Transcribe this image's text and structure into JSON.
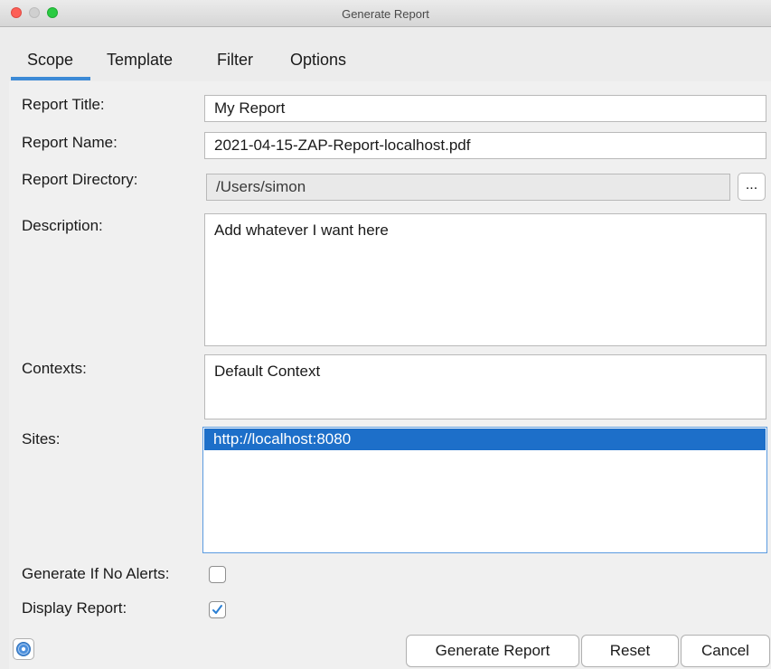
{
  "window": {
    "title": "Generate Report"
  },
  "tabs": [
    {
      "label": "Scope"
    },
    {
      "label": "Template"
    },
    {
      "label": "Filter"
    },
    {
      "label": "Options"
    }
  ],
  "form": {
    "report_title": {
      "label": "Report Title:",
      "value": "My Report"
    },
    "report_name": {
      "label": "Report Name:",
      "value": "2021-04-15-ZAP-Report-localhost.pdf"
    },
    "report_directory": {
      "label": "Report Directory:",
      "value": "/Users/simon",
      "browse_label": "..."
    },
    "description": {
      "label": "Description:",
      "value": "Add whatever I want here"
    },
    "contexts": {
      "label": "Contexts:",
      "items": [
        "Default Context"
      ]
    },
    "sites": {
      "label": "Sites:",
      "items": [
        "http://localhost:8080"
      ],
      "selected": "http://localhost:8080"
    },
    "generate_if_no_alerts": {
      "label": "Generate If No Alerts:",
      "checked": false
    },
    "display_report": {
      "label": "Display Report:",
      "checked": true
    }
  },
  "buttons": {
    "generate": "Generate Report",
    "reset": "Reset",
    "cancel": "Cancel"
  },
  "colors": {
    "accent": "#3c8ad6",
    "selection": "#1d6fc9",
    "checkmark": "#2a7fd4"
  }
}
